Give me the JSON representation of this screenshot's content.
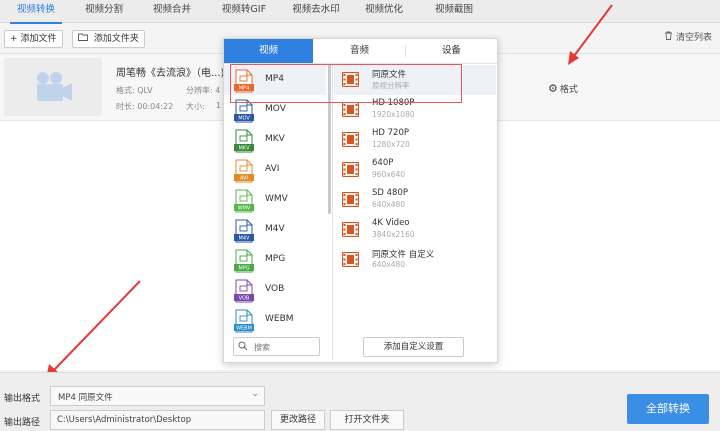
{
  "tabs": [
    {
      "label": "视频转换",
      "active": true
    },
    {
      "label": "视频分割"
    },
    {
      "label": "视频合并"
    },
    {
      "label": "视频转GIF"
    },
    {
      "label": "视频去水印"
    },
    {
      "label": "视频优化"
    },
    {
      "label": "视频截图"
    }
  ],
  "toolbar": {
    "add_file": "添加文件",
    "add_folder": "添加文件夹",
    "clear_list": "清空列表"
  },
  "file": {
    "name": "周笔畅《去流浪》（电...).(",
    "format_label": "格式: QLV",
    "resolution_label": "分辨率: 4",
    "duration_label": "时长: 00:04:22",
    "size_label": "大小:",
    "size_value": "1",
    "format_button": "格式"
  },
  "popup": {
    "tabs": [
      "视频",
      "音频",
      "设备"
    ],
    "active_tab": "视频",
    "formats": [
      {
        "label": "MP4",
        "badge": "MP4",
        "color": "#e9692c",
        "selected": true
      },
      {
        "label": "MOV",
        "badge": "MOV",
        "color": "#2b5aa5"
      },
      {
        "label": "MKV",
        "badge": "MKV",
        "color": "#3a8a3a"
      },
      {
        "label": "AVI",
        "badge": "AVI",
        "color": "#e38b2b"
      },
      {
        "label": "WMV",
        "badge": "WMV",
        "color": "#59b54a"
      },
      {
        "label": "M4V",
        "badge": "M4V",
        "color": "#2b5aa5"
      },
      {
        "label": "MPG",
        "badge": "MPG",
        "color": "#49a84a"
      },
      {
        "label": "VOB",
        "badge": "VOB",
        "color": "#7a4aa8"
      },
      {
        "label": "WEBM",
        "badge": "WEBM",
        "color": "#2b8ac8"
      }
    ],
    "presets": [
      {
        "name": "同原文件",
        "res": "原视分辨率",
        "selected": true
      },
      {
        "name": "HD 1080P",
        "res": "1920x1080"
      },
      {
        "name": "HD 720P",
        "res": "1280x720"
      },
      {
        "name": "640P",
        "res": "960x640"
      },
      {
        "name": "SD 480P",
        "res": "640x480"
      },
      {
        "name": "4K Video",
        "res": "3840x2160"
      },
      {
        "name": "同原文件 自定义",
        "res": "640x480"
      }
    ],
    "search_placeholder": "搜索",
    "custom_button": "添加自定义设置"
  },
  "bottom": {
    "output_format_label": "输出格式",
    "output_format_value": "MP4  同原文件",
    "output_path_label": "输出路径",
    "output_path_value": "C:\\Users\\Administrator\\Desktop",
    "change_path": "更改路径",
    "open_folder": "打开文件夹",
    "convert_all": "全部转换"
  },
  "colors": {
    "accent": "#2f7fe0",
    "convert_button": "#3a8ee6",
    "annotation_red": "#e53935"
  }
}
